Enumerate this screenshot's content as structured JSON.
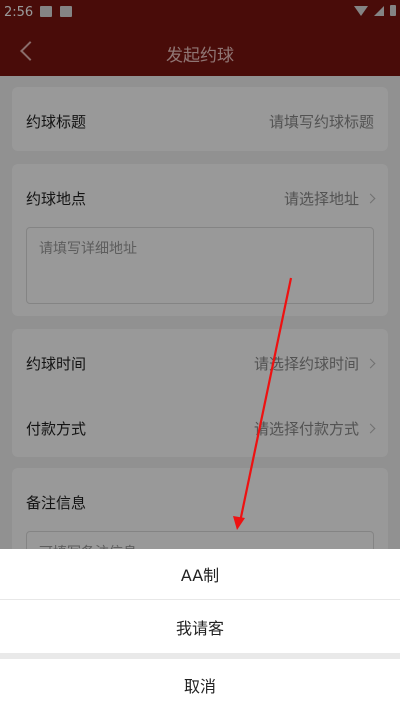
{
  "status_bar": {
    "time": "2:56"
  },
  "header": {
    "title": "发起约球"
  },
  "form": {
    "title_row": {
      "label": "约球标题",
      "placeholder": "请填写约球标题"
    },
    "location_row": {
      "label": "约球地点",
      "value": "请选择地址"
    },
    "address_placeholder": "请填写详细地址",
    "time_row": {
      "label": "约球时间",
      "value": "请选择约球时间"
    },
    "payment_row": {
      "label": "付款方式",
      "value": "请选择付款方式"
    },
    "remark_row": {
      "label": "备注信息"
    },
    "remark_placeholder": "可填写备注信息"
  },
  "action_sheet": {
    "options": [
      "AA制",
      "我请客"
    ],
    "cancel": "取消"
  },
  "colors": {
    "header_bg": "#7a1410",
    "annotation": "#e11"
  }
}
